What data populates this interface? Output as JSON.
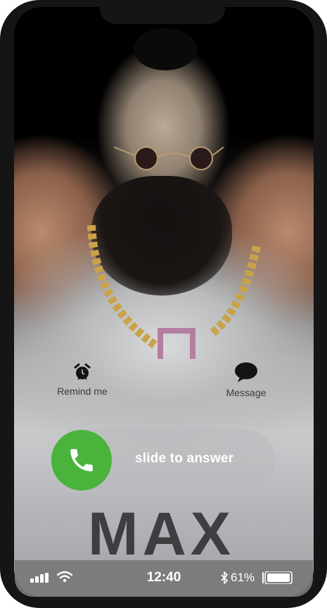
{
  "incoming_call": {
    "caller_name": "MAX",
    "actions": {
      "remind_label": "Remind me",
      "message_label": "Message"
    },
    "slider_label": "slide to answer"
  },
  "status_bar": {
    "time": "12:40",
    "battery_percent": "61%",
    "icons": [
      "signal-icon",
      "wifi-icon",
      "bluetooth-icon",
      "battery-icon"
    ]
  },
  "colors": {
    "answer_green": "#49b33c",
    "status_bar": "#787878",
    "phone_frame": "#151515"
  }
}
